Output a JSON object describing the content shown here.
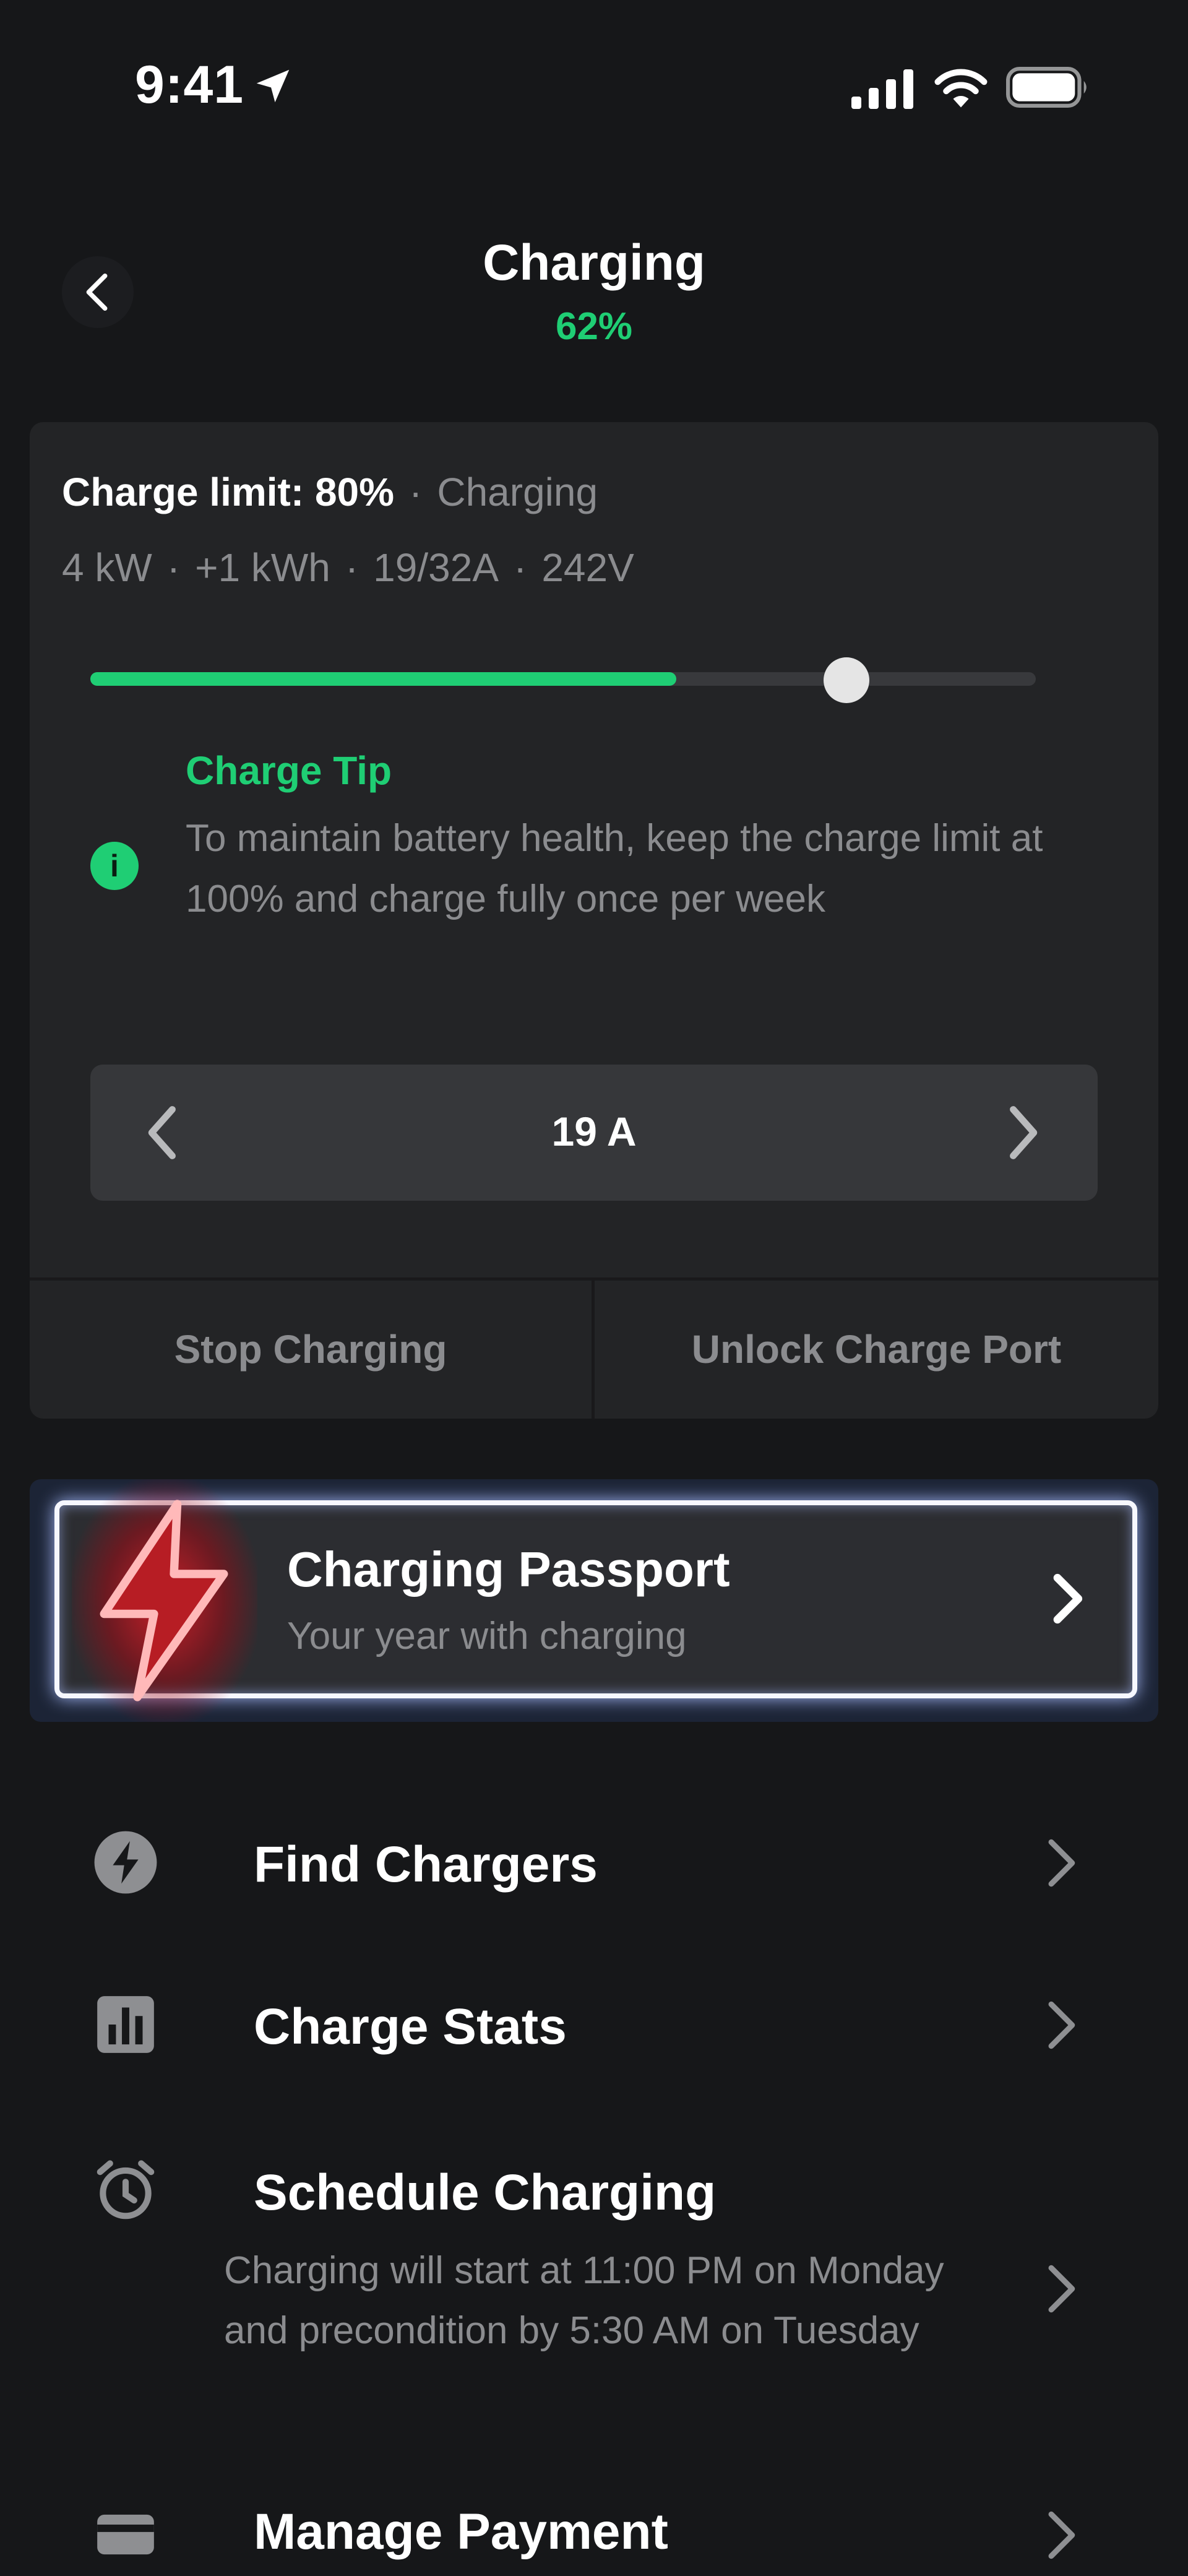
{
  "status_bar": {
    "time": "9:41"
  },
  "header": {
    "title": "Charging",
    "subtitle": "62%"
  },
  "charge_card": {
    "charge_limit": "Charge limit: 80%",
    "state": "Charging",
    "metrics": [
      "4 kW",
      "+1 kWh",
      "19/32A",
      "242V"
    ],
    "separator": "·",
    "charge_level_percent": 62,
    "charge_limit_percent": 80,
    "tip": {
      "title": "Charge Tip",
      "body": "To maintain battery health, keep the charge limit at 100% and charge fully once per week",
      "icon_glyph": "i"
    },
    "amperage": "19 A",
    "stop_label": "Stop Charging",
    "unlock_label": "Unlock Charge Port"
  },
  "passport": {
    "title": "Charging Passport",
    "subtitle": "Your year with charging"
  },
  "menu": {
    "find_chargers": "Find Chargers",
    "charge_stats": "Charge Stats",
    "schedule": {
      "label": "Schedule Charging",
      "description": "Charging will start at 11:00 PM on Monday and precondition by 5:30 AM on Tuesday"
    },
    "manage_payment": "Manage Payment"
  },
  "colors": {
    "background": "#161719",
    "card": "#232426",
    "accent_green": "#1fce74",
    "muted_text": "#8b8c8f",
    "stepper": "#36373a"
  }
}
